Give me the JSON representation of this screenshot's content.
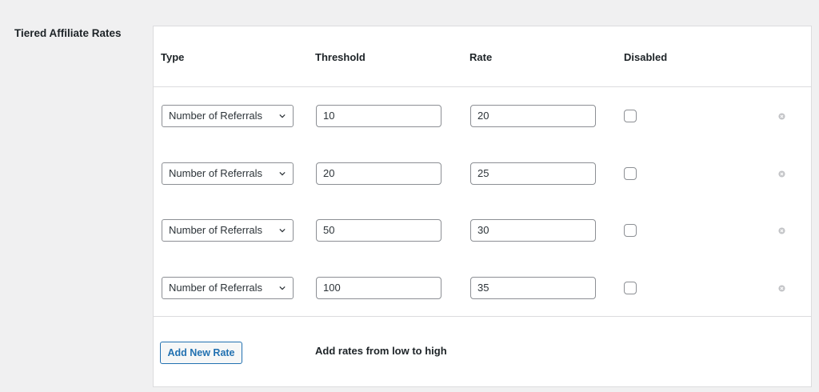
{
  "section": {
    "label": "Tiered Affiliate Rates"
  },
  "table": {
    "columns": {
      "type": "Type",
      "threshold": "Threshold",
      "rate": "Rate",
      "disabled": "Disabled"
    },
    "rows": [
      {
        "type": "Number of Referrals",
        "threshold": "10",
        "rate": "20",
        "disabled": false
      },
      {
        "type": "Number of Referrals",
        "threshold": "20",
        "rate": "25",
        "disabled": false
      },
      {
        "type": "Number of Referrals",
        "threshold": "50",
        "rate": "30",
        "disabled": false
      },
      {
        "type": "Number of Referrals",
        "threshold": "100",
        "rate": "35",
        "disabled": false
      }
    ]
  },
  "footer": {
    "add_label": "Add New Rate",
    "hint": "Add rates from low to high"
  },
  "colors": {
    "accent": "#2271b1",
    "border": "#dcdcde",
    "background": "#f0f0f1"
  },
  "icons": {
    "select": "chevron-down-icon",
    "remove": "remove-circle-icon"
  }
}
